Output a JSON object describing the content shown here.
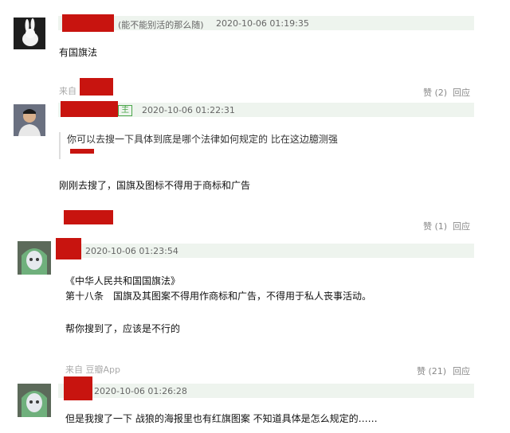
{
  "comments": [
    {
      "meta": "(能不能别活的那么随)",
      "time": "2020-10-06 01:19:35",
      "text": "有国旗法",
      "source": "来自",
      "like": "赞 (2)",
      "reply": "回应"
    },
    {
      "badge": "主",
      "time": "2020-10-06 01:22:31",
      "quote": "你可以去搜一下具体到底是哪个法律如何规定的 比在这边臆测强",
      "text": "刚刚去搜了，国旗及图标不得用于商标和广告",
      "like": "赞 (1)",
      "reply": "回应"
    },
    {
      "time": "2020-10-06 01:23:54",
      "lines": [
        "《中华人民共和国国旗法》",
        "第十八条　国旗及其图案不得用作商标和广告，不得用于私人丧事活动。",
        "帮你搜到了，应该是不行的"
      ],
      "source": "来自 豆瓣App",
      "like": "赞 (21)",
      "reply": "回应"
    },
    {
      "time": "2020-10-06 01:26:28",
      "text": "但是我搜了一下 战狼的海报里也有红旗图案 不知道具体是怎么规定的……"
    }
  ]
}
